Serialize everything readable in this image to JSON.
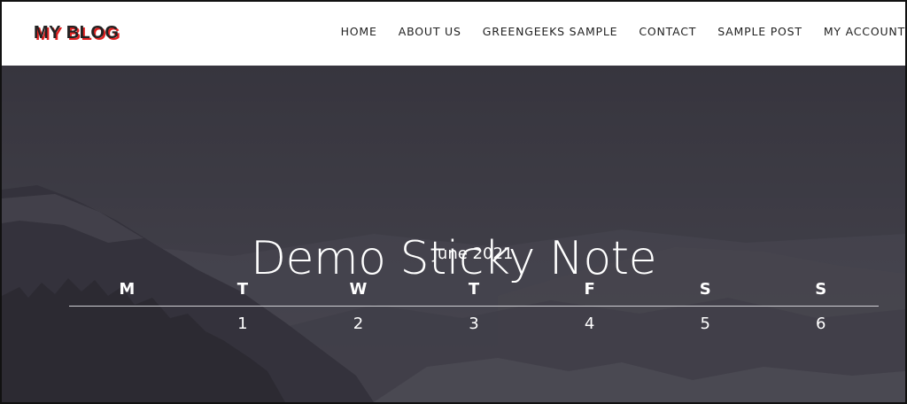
{
  "site": {
    "logo": "MY BLOG",
    "accent_color": "#e02020"
  },
  "nav": {
    "items": [
      {
        "label": "HOME"
      },
      {
        "label": "ABOUT US"
      },
      {
        "label": "GREENGEEKS SAMPLE"
      },
      {
        "label": "CONTACT"
      },
      {
        "label": "SAMPLE POST"
      },
      {
        "label": "MY ACCOUNT"
      }
    ]
  },
  "hero": {
    "title": "Demo Sticky Note"
  },
  "calendar": {
    "caption": "June 2021",
    "weekdays": [
      "M",
      "T",
      "W",
      "T",
      "F",
      "S",
      "S"
    ],
    "first_week": [
      "",
      "1",
      "2",
      "3",
      "4",
      "5",
      "6"
    ]
  }
}
